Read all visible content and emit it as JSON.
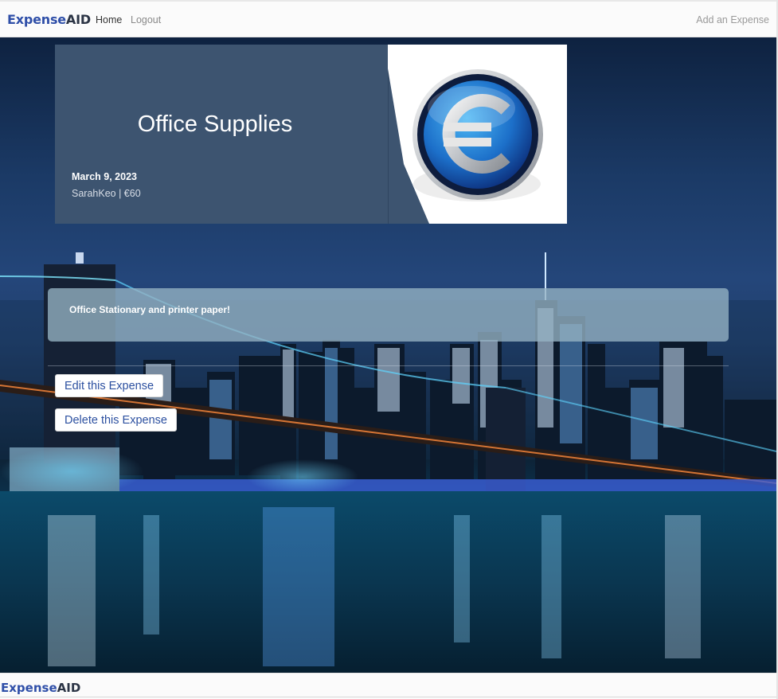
{
  "navbar": {
    "brand_part1": "Expense",
    "brand_part2": "AID",
    "links": {
      "home": "Home",
      "logout": "Logout",
      "add_expense": "Add an Expense"
    }
  },
  "expense": {
    "title": "Office Supplies",
    "date": "March 9, 2023",
    "meta": "SarahKeo | €60",
    "description": "Office Stationary and printer paper!",
    "image_icon": "euro-coin-icon"
  },
  "actions": {
    "edit_label": "Edit this Expense",
    "delete_label": "Delete this Expense"
  },
  "footer": {
    "brand_part1": "Expense",
    "brand_part2": "AID"
  },
  "colors": {
    "brand_blue": "#2f4fa8",
    "brand_dark": "#2b3445",
    "card_bg": "#3d5470",
    "button_text": "#2c50a0"
  }
}
